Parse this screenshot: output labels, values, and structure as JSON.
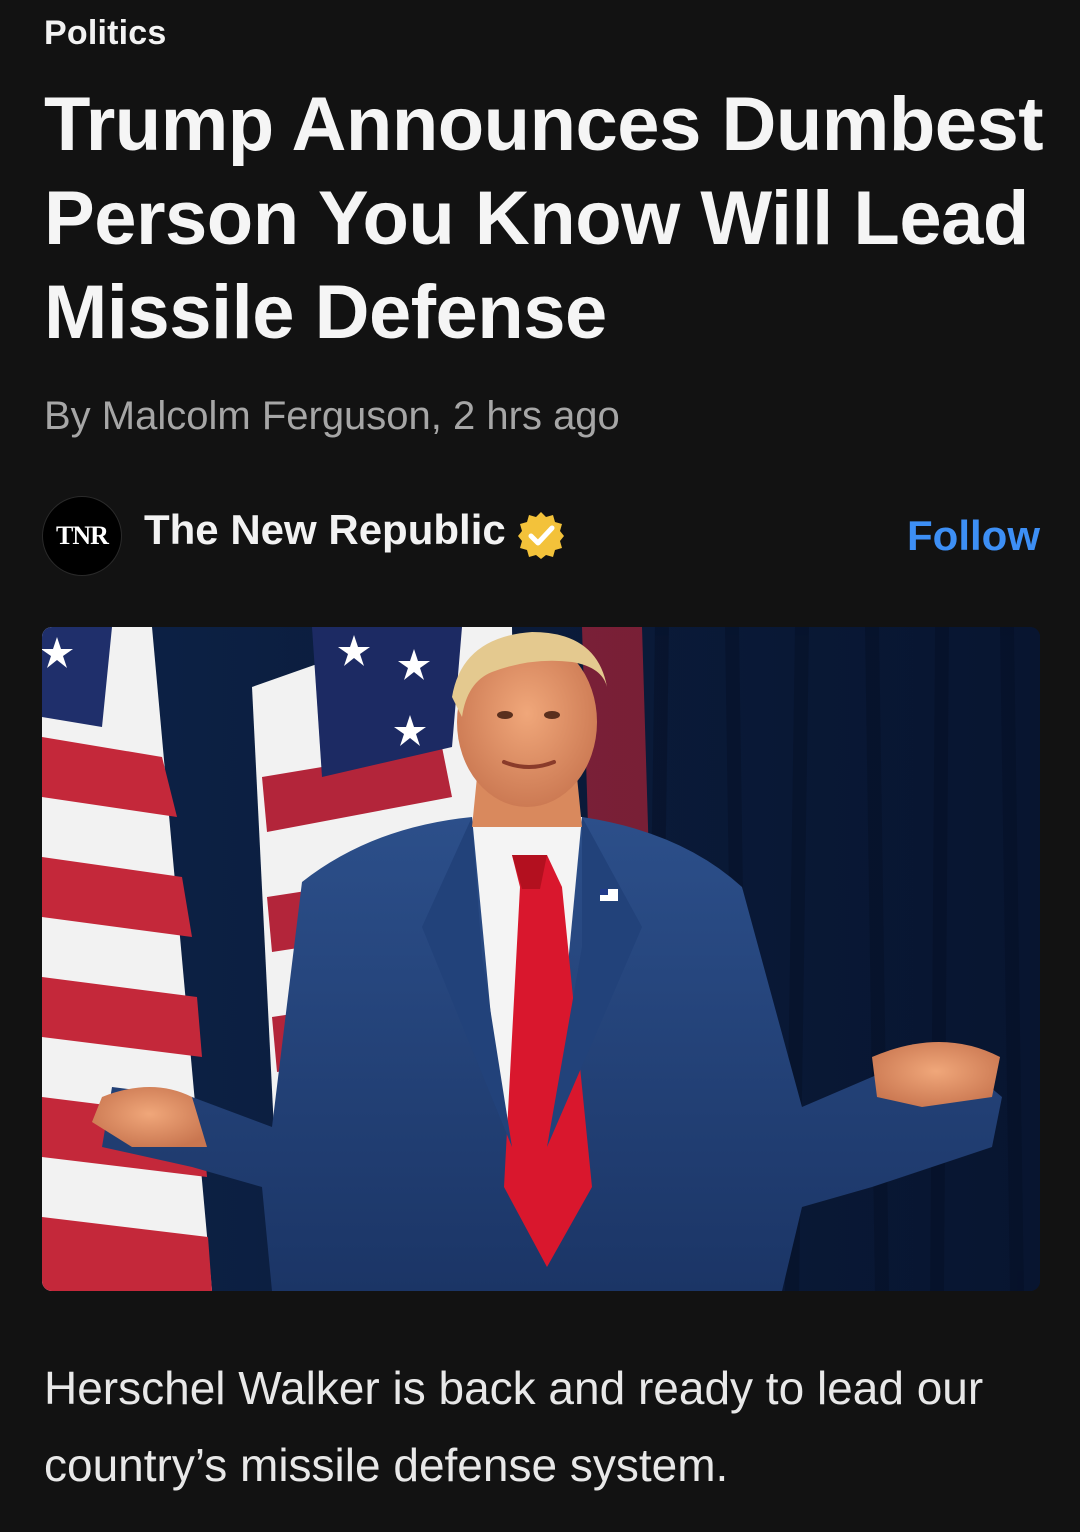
{
  "article": {
    "category": "Politics",
    "headline": "Trump Announces Dumbest Person You Know Will Lead Missile Defense",
    "byline": "By Malcolm Ferguson, 2 hrs ago",
    "summary": "Herschel Walker is back and ready to lead our country’s missile defense system."
  },
  "publisher": {
    "logo_text": "TNR",
    "name": "The New Republic",
    "verified_icon": "verified-badge-icon",
    "follow_label": "Follow"
  },
  "colors": {
    "background": "#121212",
    "accent_link": "#3d8ff5",
    "verified_badge": "#f3c23a",
    "byline": "#a6a6a6"
  }
}
